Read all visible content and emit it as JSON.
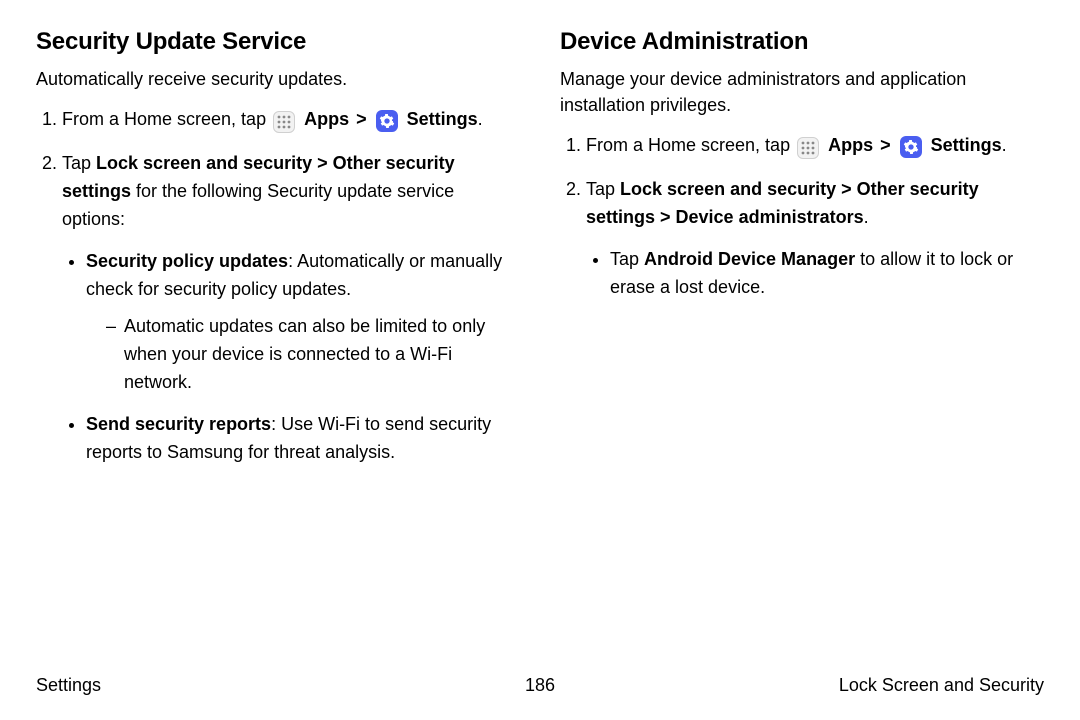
{
  "left": {
    "title": "Security Update Service",
    "intro": "Automatically receive security updates.",
    "step1_prefix": "From a Home screen, tap ",
    "apps_label": "Apps",
    "settings_label": "Settings",
    "step1_suffix": ".",
    "step2_a": "Tap ",
    "step2_b": "Lock screen and security > Other security settings",
    "step2_c": " for the following Security update service options:",
    "bullet1_bold": "Security policy updates",
    "bullet1_rest": ": Automatically or manually check for security policy updates.",
    "dash1": "Automatic updates can also be limited to only when your device is connected to a Wi-Fi network.",
    "bullet2_bold": "Send security reports",
    "bullet2_rest": ": Use Wi-Fi to send security reports to Samsung for threat analysis."
  },
  "right": {
    "title": "Device Administration",
    "intro": "Manage your device administrators and application installation privileges.",
    "step1_prefix": "From a Home screen, tap ",
    "apps_label": "Apps",
    "settings_label": "Settings",
    "step1_suffix": ".",
    "step2_a": "Tap ",
    "step2_b": "Lock screen and security > Other security settings > Device administrators",
    "step2_c": ".",
    "bullet1_a": "Tap ",
    "bullet1_b": "Android Device Manager",
    "bullet1_c": " to allow it to lock or erase a lost device."
  },
  "footer": {
    "left": "Settings",
    "center": "186",
    "right": "Lock Screen and Security"
  },
  "chevron": ">"
}
